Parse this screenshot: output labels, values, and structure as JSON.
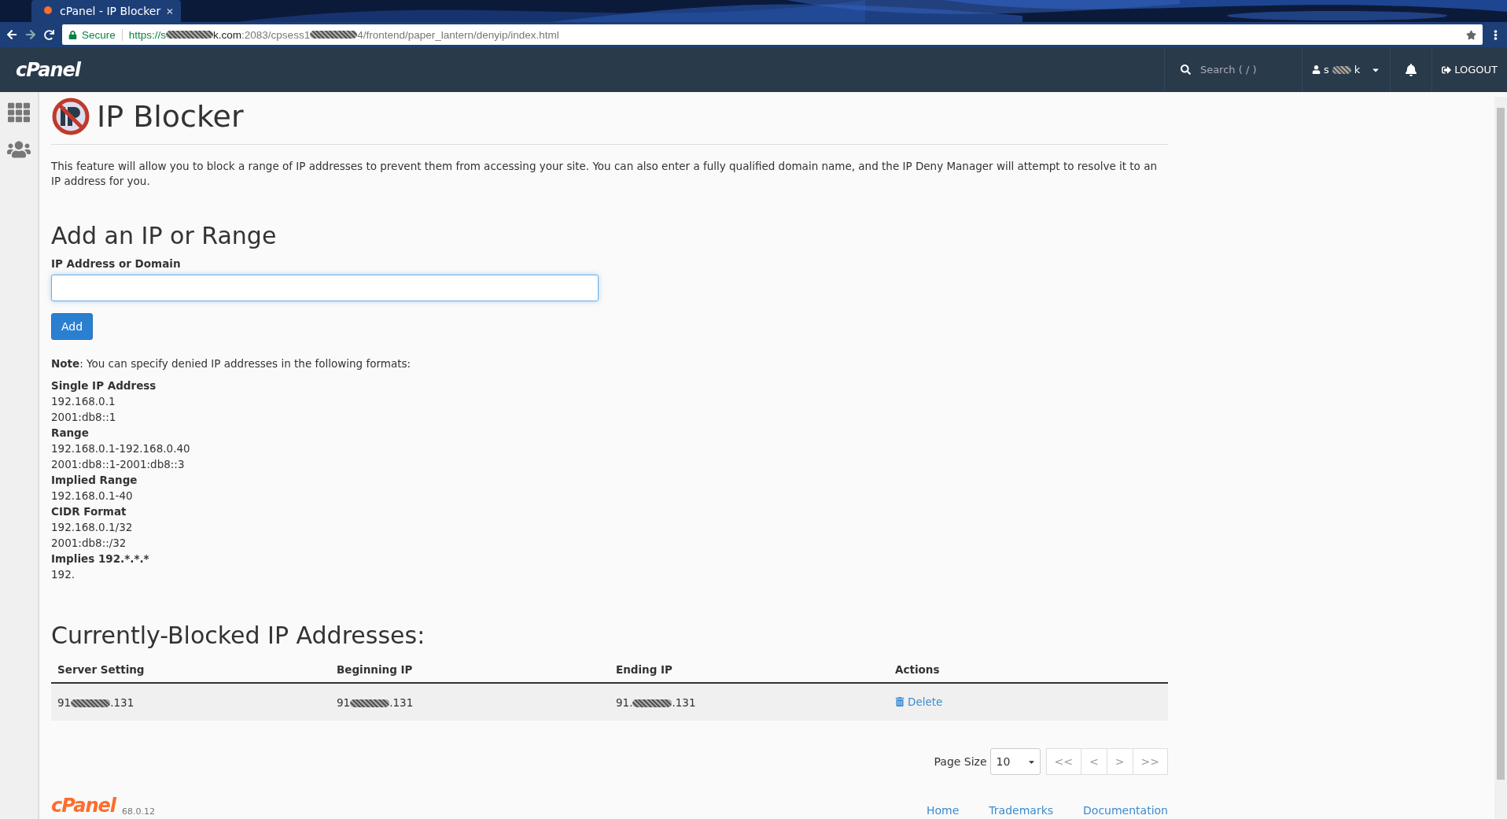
{
  "browser": {
    "tab_title": "cPanel - IP Blocker",
    "secure_label": "Secure",
    "url": [
      {
        "kind": "scheme",
        "text": "https://s"
      },
      {
        "kind": "redacted"
      },
      {
        "kind": "host",
        "text": "k.com"
      },
      {
        "kind": "path",
        "text": ":2083/cpsess1"
      },
      {
        "kind": "redacted"
      },
      {
        "kind": "path",
        "text": "4/frontend/paper_lantern/denyip/index.html"
      }
    ]
  },
  "topbar": {
    "logo": "cPanel",
    "search_placeholder": "Search ( / )",
    "user": [
      {
        "kind": "text",
        "text": "s"
      },
      {
        "kind": "redacted"
      },
      {
        "kind": "text",
        "text": "k"
      }
    ],
    "logout": "LOGOUT"
  },
  "page": {
    "title": "IP Blocker",
    "description": "This feature will allow you to block a range of IP addresses to prevent them from accessing your site. You can also enter a fully qualified domain name, and the IP Deny Manager will attempt to resolve it to an IP address for you.",
    "form": {
      "heading": "Add an IP or Range",
      "label": "IP Address or Domain",
      "button": "Add"
    },
    "note": "**Note**: You can specify denied IP addresses in the following formats:",
    "formats": [
      {
        "kind": "heading",
        "text": "Single IP Address"
      },
      {
        "kind": "line",
        "text": "192.168.0.1"
      },
      {
        "kind": "line",
        "text": "2001:db8::1"
      },
      {
        "kind": "heading",
        "text": "Range"
      },
      {
        "kind": "line",
        "text": "192.168.0.1-192.168.0.40"
      },
      {
        "kind": "line",
        "text": "2001:db8::1-2001:db8::3"
      },
      {
        "kind": "heading",
        "text": "Implied Range"
      },
      {
        "kind": "line",
        "text": "192.168.0.1-40"
      },
      {
        "kind": "heading",
        "text": "CIDR Format"
      },
      {
        "kind": "line",
        "text": "192.168.0.1/32"
      },
      {
        "kind": "line",
        "text": "2001:db8::/32"
      },
      {
        "kind": "heading",
        "text": "Implies 192.*.*.*"
      },
      {
        "kind": "line",
        "text": "192."
      }
    ],
    "table": {
      "heading": "Currently-Blocked IP Addresses:",
      "columns": [
        "Server Setting",
        "Beginning IP",
        "Ending IP",
        "Actions"
      ],
      "rows": [
        {
          "cells": [
            {
              "prefix": "91",
              "suffix": ".131"
            },
            {
              "prefix": "91",
              "suffix": ".131"
            },
            {
              "prefix": "91.",
              "suffix": ".131"
            }
          ],
          "action": "Delete"
        }
      ]
    },
    "pagination": {
      "label": "Page Size",
      "page_size": "10",
      "buttons": [
        "<<",
        "<",
        ">",
        ">>"
      ]
    }
  },
  "footer": {
    "logo": "cPanel",
    "version": "68.0.12",
    "links": [
      "Home",
      "Trademarks",
      "Documentation"
    ]
  }
}
